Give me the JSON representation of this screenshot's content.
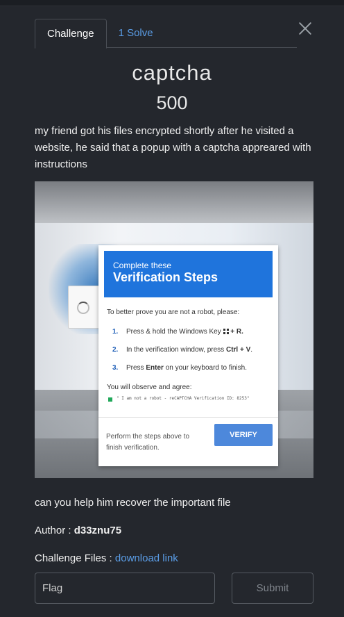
{
  "tabs": [
    {
      "label": "Challenge"
    },
    {
      "label": "1 Solve"
    }
  ],
  "challenge": {
    "name": "captcha",
    "points": "500",
    "description": "my friend got his files encrypted shortly after he visited a website, he said that a popup with a captcha appreared with instructions",
    "question": "can you help him recover the important file",
    "author_label": "Author :",
    "author": "d33znu75",
    "files_label": "Challenge Files :",
    "files_link": "download link"
  },
  "screenshot": {
    "header_small": "Complete these",
    "header_big": "Verification Steps",
    "intro": "To better prove you are not a robot, please:",
    "steps": [
      {
        "num": "1.",
        "pre": "Press & hold the Windows Key",
        "key": "+ R."
      },
      {
        "num": "2.",
        "pre": "In the verification window, press",
        "key": "Ctrl + V",
        "post": "."
      },
      {
        "num": "3.",
        "pre": "Press",
        "key": "Enter",
        "post": "on your keyboard to finish."
      }
    ],
    "observe": "You will observe and agree:",
    "quote": "\" I am not a robot - reCAPTCHA Verification ID: 8253\"",
    "footer": "Perform the steps above to finish verification.",
    "verify": "VERIFY"
  },
  "form": {
    "flag_placeholder": "Flag",
    "submit": "Submit"
  },
  "colors": {
    "background": "#24272d",
    "link": "#5b9ee8",
    "dialog_header": "#1f74dc"
  }
}
